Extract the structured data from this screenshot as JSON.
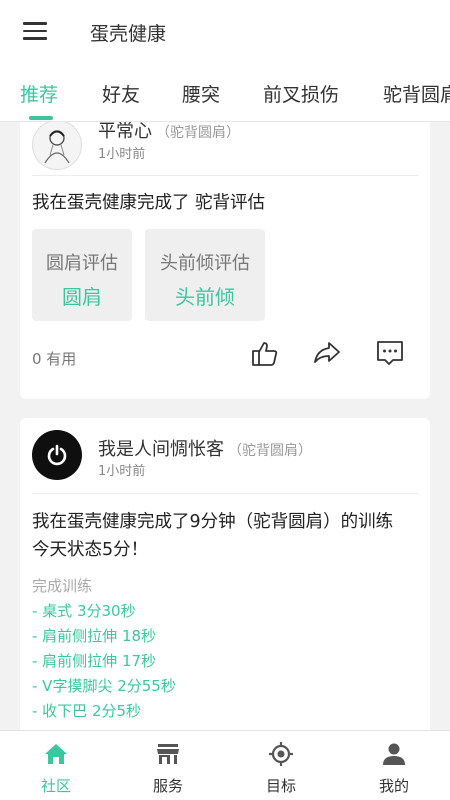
{
  "app": {
    "title": "蛋壳健康"
  },
  "tabs": [
    {
      "label": "推荐",
      "active": true
    },
    {
      "label": "好友",
      "active": false
    },
    {
      "label": "腰突",
      "active": false
    },
    {
      "label": "前叉损伤",
      "active": false
    },
    {
      "label": "驼背圆肩",
      "active": false
    }
  ],
  "posts": [
    {
      "user": "平常心",
      "tag": "（驼背圆肩）",
      "time": "1小时前",
      "text": "我在蛋壳健康完成了 驼背评估",
      "evaluations": [
        {
          "title": "圆肩评估",
          "result": "圆肩"
        },
        {
          "title": "头前倾评估",
          "result": "头前倾"
        }
      ],
      "useful": "0 有用"
    },
    {
      "user": "我是人间惆怅客",
      "tag": "（驼背圆肩）",
      "time": "1小时前",
      "text": "我在蛋壳健康完成了9分钟（驼背圆肩）的训练 今天状态5分！",
      "section_label": "完成训练",
      "training": [
        "- 桌式 3分30秒",
        "- 肩前侧拉伸 18秒",
        "- 肩前侧拉伸 17秒",
        "- V字摸脚尖 2分55秒",
        "- 收下巴 2分5秒"
      ]
    }
  ],
  "bottom_nav": [
    {
      "label": "社区",
      "icon": "home-icon",
      "active": true
    },
    {
      "label": "服务",
      "icon": "store-icon",
      "active": false
    },
    {
      "label": "目标",
      "icon": "target-icon",
      "active": false
    },
    {
      "label": "我的",
      "icon": "person-icon",
      "active": false
    }
  ],
  "colors": {
    "accent": "#3cc6a0",
    "background": "#f2f2f2"
  }
}
